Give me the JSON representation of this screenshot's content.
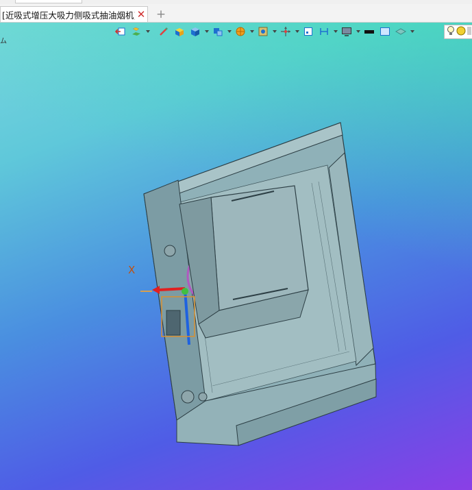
{
  "window": {
    "tab_title": "[近吸式增压大吸力侧吸式抽油烟机]",
    "tab_close_glyph": "✕",
    "new_tab_glyph": "+"
  },
  "viewport": {
    "corner_text": "ム",
    "axis_label_x": "X",
    "background_colors": [
      "#79d6de",
      "#4a8fe0",
      "#8a3fe6",
      "#3ce6aa"
    ]
  },
  "toolbar": {
    "icons": [
      "exit-view-icon",
      "display-style-icon",
      "measure-icon",
      "shaded-box-icon",
      "cube-view-icon",
      "view-orientation-icon",
      "section-color-icon",
      "render-icon",
      "axis-triad-icon",
      "frame-icon",
      "dimension-icon",
      "monitor-icon",
      "color-black-icon",
      "color-box-icon",
      "layer-icon",
      "lightbulb-icon",
      "light-sphere-icon"
    ],
    "accent": "#1e6fd0"
  }
}
